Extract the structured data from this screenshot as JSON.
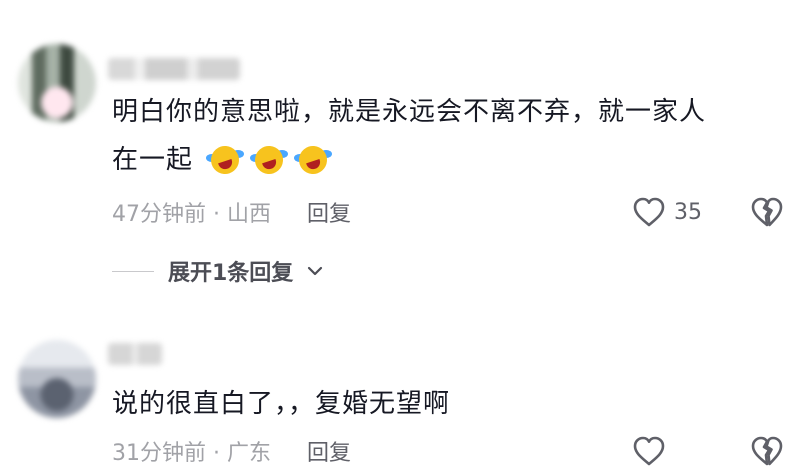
{
  "comments": [
    {
      "text_line1": "明白你的意思啦，就是永远会不离不弃，就一家人",
      "text_line2": "在一起",
      "emojis": [
        "crying-laughing-emoji",
        "crying-laughing-emoji",
        "crying-laughing-emoji"
      ],
      "time_location": "47分钟前 · 山西",
      "reply_label": "回复",
      "likes": "35",
      "expand_label": "展开1条回复"
    },
    {
      "text_line1": "说的很直白了，，复婚无望啊",
      "time_location": "31分钟前 · 广东",
      "reply_label": "回复"
    }
  ],
  "icons": {
    "like": "heart-outline-icon",
    "dislike": "broken-heart-outline-icon",
    "expand": "chevron-down-icon"
  },
  "colors": {
    "text": "#161823",
    "meta": "#a1a2a7",
    "emoji_face": "#f7c31e",
    "emoji_tear": "#4aa7ff"
  }
}
